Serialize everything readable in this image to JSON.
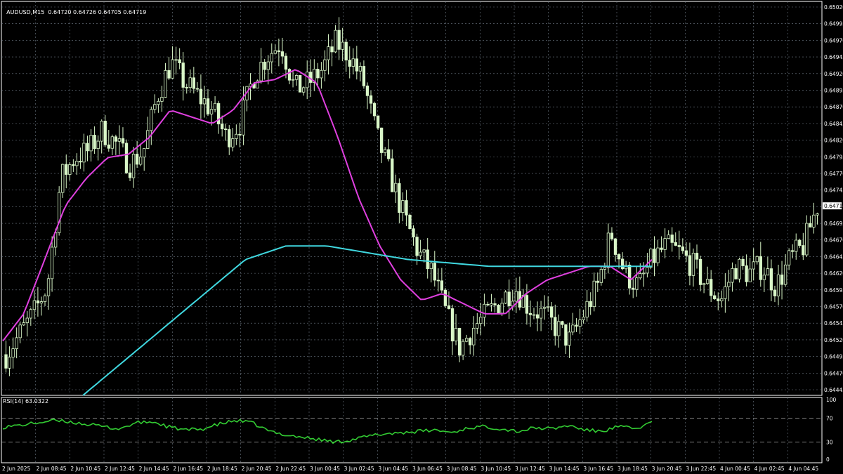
{
  "header": {
    "symbol": "AUDUSD,M15",
    "ohlc": "0.64720 0.64726 0.64705 0.64719"
  },
  "rsi_header": "RSI(14) 63.0322",
  "colors": {
    "background": "#000000",
    "grid": "#6f7a86",
    "candle": "#d9f7c8",
    "ma_fast": "#e040e0",
    "ma_slow": "#40d8e0",
    "rsi": "#33cc33",
    "rsi_levels": "#aaaaaa"
  },
  "current_price": "0.64719",
  "rsi_levels": {
    "upper": "70",
    "lower": "30",
    "max": "100",
    "min": "0"
  },
  "chart_data": {
    "type": "candlestick",
    "instrument": "AUDUSD",
    "timeframe": "M15",
    "price_axis_labels": [
      "0.65020",
      "0.64995",
      "0.64970",
      "0.64945",
      "0.64920",
      "0.64895",
      "0.64870",
      "0.64845",
      "0.64820",
      "0.64795",
      "0.64770",
      "0.64745",
      "0.64719",
      "0.64695",
      "0.64670",
      "0.64645",
      "0.64620",
      "0.64595",
      "0.64570",
      "0.64545",
      "0.64520",
      "0.64495",
      "0.64470",
      "0.64445"
    ],
    "price_range": [
      0.6444,
      0.6502
    ],
    "time_axis_labels": [
      "2 Jun 2025",
      "2 Jun 08:45",
      "2 Jun 10:45",
      "2 Jun 12:45",
      "2 Jun 14:45",
      "2 Jun 16:45",
      "2 Jun 18:45",
      "2 Jun 20:45",
      "2 Jun 22:45",
      "3 Jun 00:45",
      "3 Jun 02:45",
      "3 Jun 04:45",
      "3 Jun 06:45",
      "3 Jun 08:45",
      "3 Jun 10:45",
      "3 Jun 12:45",
      "3 Jun 14:45",
      "3 Jun 16:45",
      "3 Jun 18:45",
      "3 Jun 20:45",
      "3 Jun 22:45",
      "4 Jun 00:45",
      "4 Jun 02:45",
      "4 Jun 04:45"
    ],
    "close_anchors": [
      0.645,
      0.6453,
      0.6456,
      0.646,
      0.6476,
      0.6479,
      0.648,
      0.6483,
      0.6481,
      0.6478,
      0.648,
      0.6488,
      0.6493,
      0.649,
      0.6488,
      0.6486,
      0.6482,
      0.6484,
      0.6491,
      0.6494,
      0.6496,
      0.6489,
      0.649,
      0.6492,
      0.6496,
      0.6494,
      0.649,
      0.6482,
      0.6476,
      0.647,
      0.6465,
      0.6462,
      0.6456,
      0.6451,
      0.6454,
      0.6456,
      0.6458,
      0.646,
      0.6457,
      0.6456,
      0.6454,
      0.6452,
      0.6456,
      0.646,
      0.6468,
      0.6462,
      0.646,
      0.6464,
      0.6466,
      0.6465,
      0.6463,
      0.646,
      0.6458,
      0.6463,
      0.6462,
      0.6463,
      0.646,
      0.6464,
      0.6466,
      0.64719
    ],
    "ma_fast_anchors": [
      0.6452,
      0.6456,
      0.6464,
      0.6472,
      0.6476,
      0.6479,
      0.64795,
      0.6482,
      0.6486,
      0.6485,
      0.6484,
      0.6486,
      0.649,
      0.64905,
      0.6492,
      0.649,
      0.6482,
      0.6473,
      0.6466,
      0.6461,
      0.6458,
      0.6459,
      0.64575,
      0.6456,
      0.6456,
      0.6459,
      0.6461,
      0.6462,
      0.6463,
      0.6463,
      0.6461,
      0.6464
    ],
    "ma_slow_anchors": [
      0.6444,
      0.6449,
      0.6454,
      0.6459,
      0.6464,
      0.6466,
      0.6466,
      0.6465,
      0.6464,
      0.64635,
      0.6463,
      0.6463,
      0.6463,
      0.6463,
      0.6463
    ],
    "rsi_range": [
      0,
      100
    ],
    "rsi_anchors": [
      55,
      58,
      62,
      66,
      64,
      60,
      56,
      52,
      62,
      64,
      55,
      50,
      52,
      60,
      66,
      62,
      48,
      42,
      38,
      34,
      30,
      34,
      40,
      44,
      46,
      48,
      50,
      46,
      54,
      56,
      52,
      48,
      54,
      52,
      58,
      50,
      48,
      56,
      52,
      63
    ]
  }
}
